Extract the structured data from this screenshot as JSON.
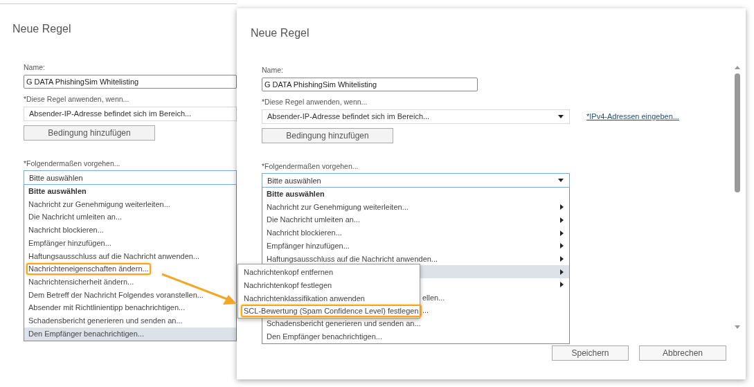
{
  "dialogs": [
    {
      "cut_off": true,
      "title": "Neue Regel",
      "name_label": "Name:",
      "name_value": "G DATA PhishingSim Whitelisting",
      "condition_label": "*Diese Regel anwenden, wenn...",
      "condition_value": "Absender-IP-Adresse befindet sich im Bereich...",
      "add_condition_button": "Bedingung hinzufügen",
      "action_label": "*Folgendermaßen vorgehen...",
      "action_value": "Bitte auswählen",
      "action_items": [
        {
          "text": "Bitte auswählen",
          "kind": "header",
          "selected": false,
          "highlighted": false
        },
        {
          "text": "Nachricht zur Genehmigung weiterleiten...",
          "kind": "full",
          "selected": false,
          "highlighted": false
        },
        {
          "text": "Die Nachricht umleiten an...",
          "kind": "full",
          "selected": false,
          "highlighted": false
        },
        {
          "text": "Nachricht blockieren...",
          "kind": "full",
          "selected": false,
          "highlighted": false
        },
        {
          "text": "Empfänger hinzufügen...",
          "kind": "full",
          "selected": false,
          "highlighted": false
        },
        {
          "text": "Haftungsausschluss auf die Nachricht anwenden...",
          "kind": "full",
          "selected": false,
          "highlighted": false
        },
        {
          "text": "Nachrichteneigenschaften ändern...",
          "kind": "full",
          "selected": false,
          "highlighted": true
        },
        {
          "text": "Nachrichtensicherheit ändern...",
          "kind": "full",
          "selected": false,
          "highlighted": false
        },
        {
          "text": "Dem Betreff der Nachricht Folgendes voranstellen...",
          "kind": "full",
          "selected": false,
          "highlighted": false
        },
        {
          "text": "Absender mit Richtlinientipp benachrichtigen...",
          "kind": "full",
          "selected": false,
          "highlighted": false
        },
        {
          "text": "Schadensbericht generieren und senden an...",
          "kind": "full",
          "selected": false,
          "highlighted": false
        },
        {
          "text": "Den Empfänger benachrichtigen...",
          "kind": "full",
          "selected": true,
          "highlighted": false
        }
      ]
    },
    {
      "cut_off": false,
      "title": "Neue Regel",
      "name_label": "Name:",
      "name_value": "G DATA PhishingSim Whitelisting",
      "condition_label": "*Diese Regel anwenden, wenn...",
      "condition_value": "Absender-IP-Adresse befindet sich im Bereich...",
      "link": "*IPv4-Adressen eingeben...",
      "add_condition_button": "Bedingung hinzufügen",
      "action_label": "*Folgendermaßen vorgehen...",
      "action_value": "Bitte auswählen",
      "action_items": [
        {
          "text": "Bitte auswählen",
          "kind": "header",
          "selected": false,
          "highlighted": false,
          "submenu": false
        },
        {
          "text": "Nachricht zur Genehmigung weiterleiten...",
          "kind": "full",
          "selected": false,
          "highlighted": false,
          "submenu": true
        },
        {
          "text": "Die Nachricht umleiten an...",
          "kind": "full",
          "selected": false,
          "highlighted": false,
          "submenu": true
        },
        {
          "text": "Nachricht blockieren...",
          "kind": "full",
          "selected": false,
          "highlighted": false,
          "submenu": true
        },
        {
          "text": "Empfänger hinzufügen...",
          "kind": "full",
          "selected": false,
          "highlighted": false,
          "submenu": true
        },
        {
          "text": "Haftungsausschluss auf die Nachricht anwenden...",
          "kind": "full",
          "selected": false,
          "highlighted": false,
          "submenu": true
        },
        {
          "kind": "covered",
          "selected": true,
          "submenu": true
        },
        {
          "kind": "covered",
          "selected": false,
          "submenu": true
        },
        {
          "text": "ellen...",
          "kind": "partial",
          "selected": false,
          "highlighted": false,
          "submenu": false
        },
        {
          "text": "...",
          "kind": "partial",
          "selected": false,
          "highlighted": false,
          "submenu": false
        },
        {
          "text": "Schadensbericht generieren und senden an...",
          "kind": "full",
          "selected": false,
          "highlighted": false,
          "submenu": false
        },
        {
          "text": "Den Empfänger benachrichtigen...",
          "kind": "full",
          "selected": false,
          "highlighted": false,
          "submenu": false
        }
      ],
      "buttons": [
        "Speichern",
        "Abbrechen"
      ]
    }
  ],
  "submenu": {
    "items": [
      {
        "text": "Nachrichtenkopf entfernen",
        "highlighted": false
      },
      {
        "text": "Nachrichtenkopf festlegen",
        "highlighted": false
      },
      {
        "text": "Nachrichtenklassifikation anwenden",
        "highlighted": false
      },
      {
        "text": "SCL-Bewertung (Spam Confidence Level) festlegen",
        "highlighted": true
      }
    ]
  }
}
